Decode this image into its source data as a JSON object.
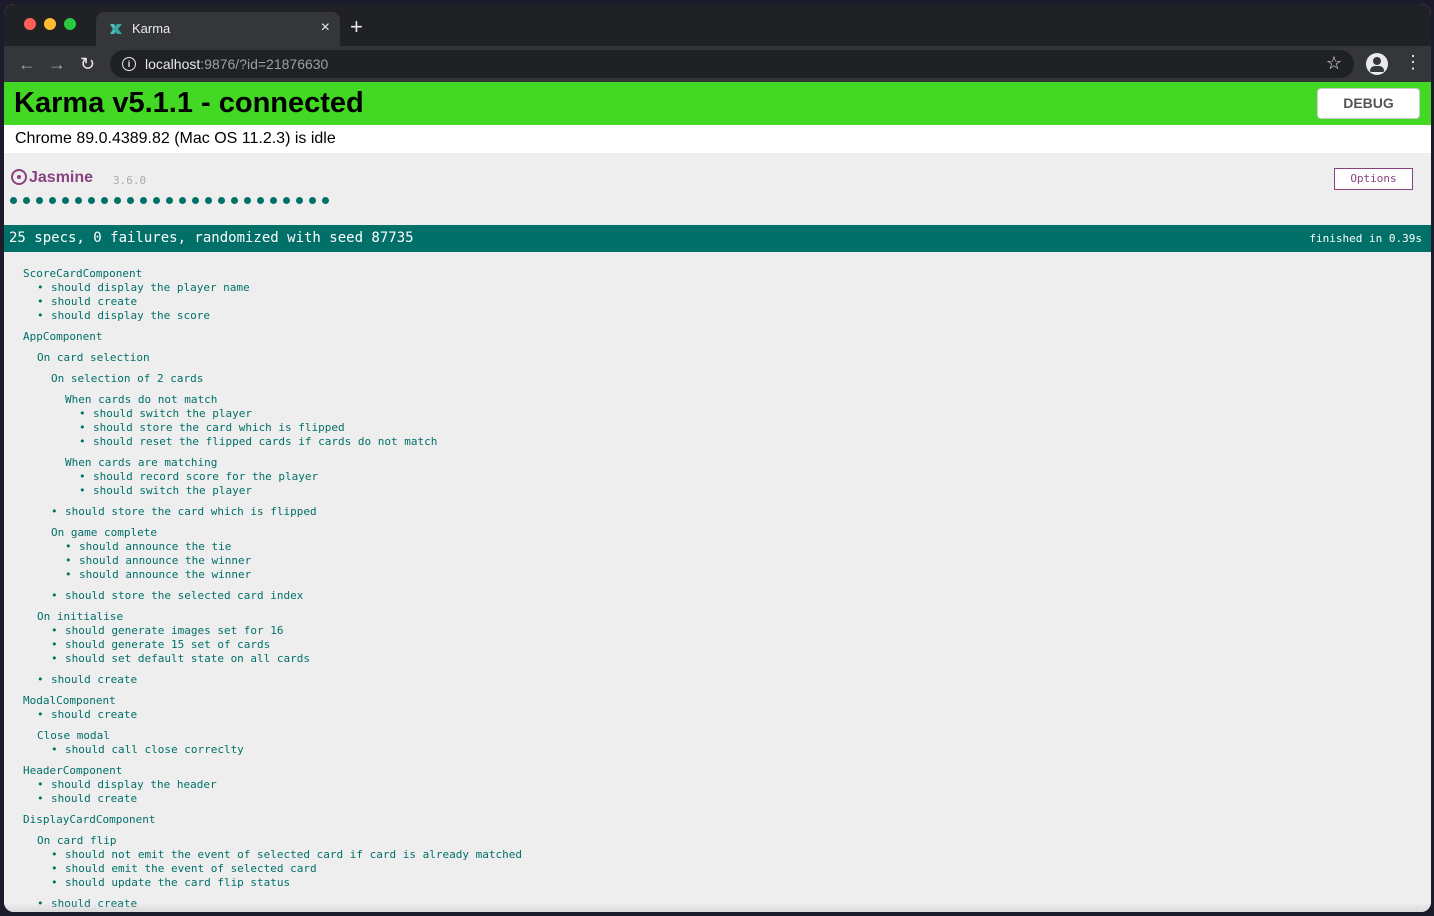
{
  "browser": {
    "tab_title": "Karma",
    "tab_close": "×",
    "new_tab": "+",
    "url_host": "localhost",
    "url_rest": ":9876/?id=21876630"
  },
  "karma": {
    "banner_title": "Karma v5.1.1 - connected",
    "debug_label": "DEBUG",
    "browser_status": "Chrome 89.0.4389.82 (Mac OS 11.2.3) is idle",
    "banner_color": "#42d823"
  },
  "jasmine": {
    "logo_text": "Jasmine",
    "version": "3.6.0",
    "options_label": "Options",
    "dot_count": 25,
    "summary": "25 specs, 0 failures, randomized with seed 87735",
    "finished": "finished in 0.39s",
    "accent_color": "#007069",
    "results": [
      {
        "kind": "suite",
        "depth": 0,
        "text": "ScoreCardComponent"
      },
      {
        "kind": "spec",
        "depth": 1,
        "text": "should display the player name"
      },
      {
        "kind": "spec",
        "depth": 1,
        "text": "should create"
      },
      {
        "kind": "spec",
        "depth": 1,
        "text": "should display the score"
      },
      {
        "kind": "suite",
        "depth": 0,
        "text": "AppComponent"
      },
      {
        "kind": "suite",
        "depth": 1,
        "text": "On card selection"
      },
      {
        "kind": "suite",
        "depth": 2,
        "text": "On selection of 2 cards"
      },
      {
        "kind": "suite",
        "depth": 3,
        "text": "When cards do not match"
      },
      {
        "kind": "spec",
        "depth": 4,
        "text": "should switch the player"
      },
      {
        "kind": "spec",
        "depth": 4,
        "text": "should store the card which is flipped"
      },
      {
        "kind": "spec",
        "depth": 4,
        "text": "should reset the flipped cards if cards do not match"
      },
      {
        "kind": "suite",
        "depth": 3,
        "text": "When cards are matching"
      },
      {
        "kind": "spec",
        "depth": 4,
        "text": "should record score for the player"
      },
      {
        "kind": "spec",
        "depth": 4,
        "text": "should switch the player"
      },
      {
        "kind": "spec",
        "depth": 2,
        "text": "should store the card which is flipped"
      },
      {
        "kind": "suite",
        "depth": 2,
        "text": "On game complete"
      },
      {
        "kind": "spec",
        "depth": 3,
        "text": "should announce the tie"
      },
      {
        "kind": "spec",
        "depth": 3,
        "text": "should announce the winner"
      },
      {
        "kind": "spec",
        "depth": 3,
        "text": "should announce the winner"
      },
      {
        "kind": "spec",
        "depth": 2,
        "text": "should store the selected card index"
      },
      {
        "kind": "suite",
        "depth": 1,
        "text": "On initialise"
      },
      {
        "kind": "spec",
        "depth": 2,
        "text": "should generate images set for 16"
      },
      {
        "kind": "spec",
        "depth": 2,
        "text": "should generate 15 set of cards"
      },
      {
        "kind": "spec",
        "depth": 2,
        "text": "should set default state on all cards"
      },
      {
        "kind": "spec",
        "depth": 1,
        "text": "should create"
      },
      {
        "kind": "suite",
        "depth": 0,
        "text": "ModalComponent"
      },
      {
        "kind": "spec",
        "depth": 1,
        "text": "should create"
      },
      {
        "kind": "suite",
        "depth": 1,
        "text": "Close modal"
      },
      {
        "kind": "spec",
        "depth": 2,
        "text": "should call close correclty"
      },
      {
        "kind": "suite",
        "depth": 0,
        "text": "HeaderComponent"
      },
      {
        "kind": "spec",
        "depth": 1,
        "text": "should display the header"
      },
      {
        "kind": "spec",
        "depth": 1,
        "text": "should create"
      },
      {
        "kind": "suite",
        "depth": 0,
        "text": "DisplayCardComponent"
      },
      {
        "kind": "suite",
        "depth": 1,
        "text": "On card flip"
      },
      {
        "kind": "spec",
        "depth": 2,
        "text": "should not emit the event of selected card if card is already matched"
      },
      {
        "kind": "spec",
        "depth": 2,
        "text": "should emit the event of selected card"
      },
      {
        "kind": "spec",
        "depth": 2,
        "text": "should update the card flip status"
      },
      {
        "kind": "spec",
        "depth": 1,
        "text": "should create"
      }
    ]
  }
}
